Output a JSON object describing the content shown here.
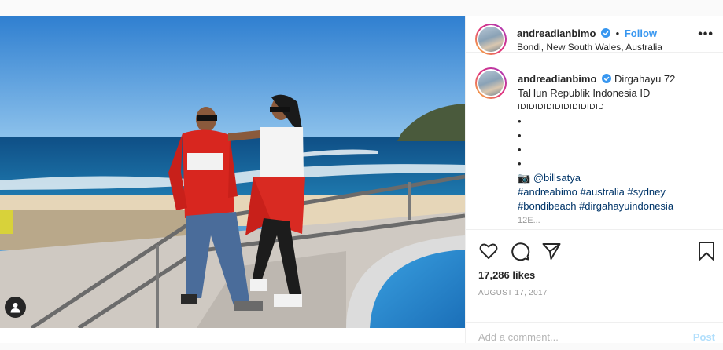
{
  "post": {
    "username": "andreadianbimo",
    "separator": "•",
    "follow_label": "Follow",
    "location": "Bondi, New South Wales, Australia",
    "more_label": "•••"
  },
  "caption": {
    "username": "andreadianbimo",
    "text_line1": "Dirgahayu 72",
    "text_line2": "TaHun Republik Indonesia ID",
    "text_line3": "IDIDIDIDIDIDIDIDIDID",
    "bullets": [
      "•",
      "•",
      "•",
      "•"
    ],
    "camera": "📷",
    "credit": "@billsatya",
    "hashtags_line1": "#andreabimo #australia #sydney",
    "hashtags_line2": "#bondibeach #dirgahayuindonesia",
    "truncated": "12E..."
  },
  "stats": {
    "likes": "17,286 likes",
    "date": "AUGUST 17, 2017"
  },
  "comment": {
    "placeholder": "Add a comment...",
    "post_label": "Post"
  },
  "icons": {
    "like": "heart-icon",
    "comment": "comment-icon",
    "share": "paper-plane-icon",
    "save": "bookmark-icon",
    "verified": "verified-badge-icon",
    "tag": "user-tag-icon"
  },
  "colors": {
    "accent": "#3897f0",
    "verified": "#3897f0",
    "link": "#003569",
    "muted": "#999999"
  }
}
